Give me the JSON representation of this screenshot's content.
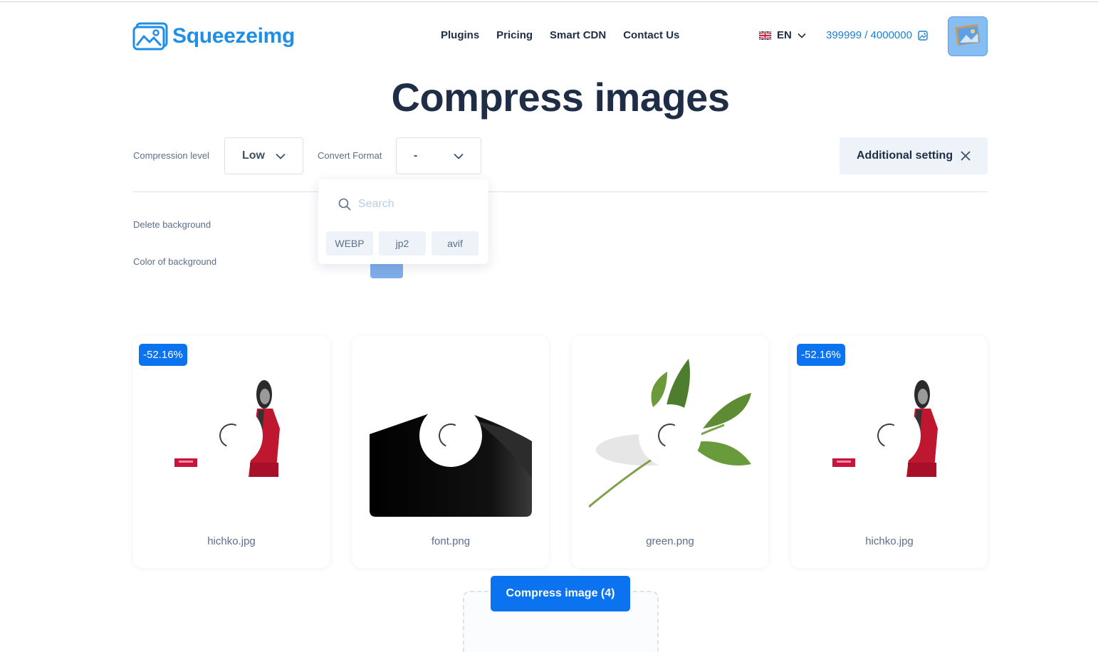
{
  "header": {
    "logo_text": "Squeezeimg",
    "nav": [
      "Plugins",
      "Pricing",
      "Smart CDN",
      "Contact Us"
    ],
    "language": "EN",
    "quota": "399999 / 4000000"
  },
  "page_title": "Compress images",
  "controls": {
    "compression_label": "Compression level",
    "compression_value": "Low",
    "convert_label": "Convert Format",
    "convert_value": "-",
    "additional_setting": "Additional setting",
    "delete_background_label": "Delete background",
    "color_background_label": "Color of background",
    "color_background_value": "#7eaee8"
  },
  "format_dropdown": {
    "search_placeholder": "Search",
    "options": [
      "WEBP",
      "jp2",
      "avif"
    ]
  },
  "cards": [
    {
      "filename": "hichko.jpg",
      "badge": "-52.16%"
    },
    {
      "filename": "font.png",
      "badge": ""
    },
    {
      "filename": "green.png",
      "badge": ""
    },
    {
      "filename": "hichko.jpg",
      "badge": "-52.16%"
    }
  ],
  "compress_button": "Compress image (4)",
  "colors": {
    "brand_blue": "#0b73f0",
    "logo_blue": "#1f8fe6",
    "text_dark": "#1f2d47"
  }
}
